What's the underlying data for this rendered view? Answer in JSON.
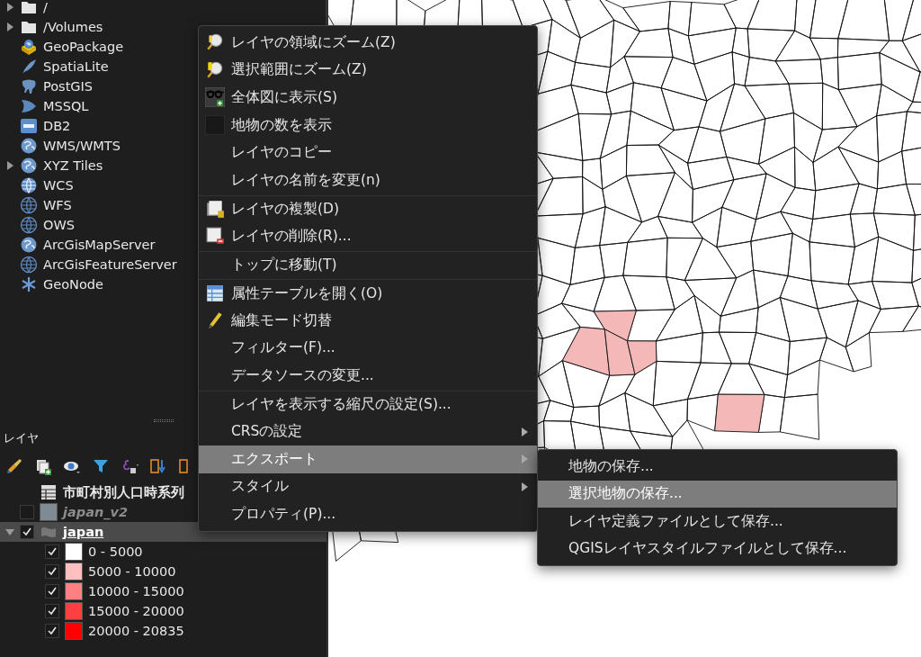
{
  "browser": {
    "items": [
      {
        "label": "/",
        "expandable": true
      },
      {
        "label": "/Volumes",
        "expandable": true
      },
      {
        "label": "GeoPackage",
        "expandable": false
      },
      {
        "label": "SpatiaLite",
        "expandable": false
      },
      {
        "label": "PostGIS",
        "expandable": false
      },
      {
        "label": "MSSQL",
        "expandable": false
      },
      {
        "label": "DB2",
        "expandable": false
      },
      {
        "label": "WMS/WMTS",
        "expandable": false
      },
      {
        "label": "XYZ Tiles",
        "expandable": true
      },
      {
        "label": "WCS",
        "expandable": false
      },
      {
        "label": "WFS",
        "expandable": false
      },
      {
        "label": "OWS",
        "expandable": false
      },
      {
        "label": "ArcGisMapServer",
        "expandable": false
      },
      {
        "label": "ArcGisFeatureServer",
        "expandable": false
      },
      {
        "label": "GeoNode",
        "expandable": false
      }
    ]
  },
  "layers_panel": {
    "title": "レイヤ",
    "tree": [
      {
        "label": "市町村別人口時系列",
        "kind": "table",
        "selected": false
      },
      {
        "label": "japan_v2",
        "kind": "layer",
        "checked": false,
        "selected": false,
        "color": "#7f8b94"
      },
      {
        "label": "japan",
        "kind": "polygon-layer",
        "checked": true,
        "expanded": true,
        "selected": true,
        "children": [
          {
            "label": "0 - 5000",
            "checked": true,
            "color": "#ffffff"
          },
          {
            "label": "5000 - 10000",
            "checked": true,
            "color": "#ffbfbf"
          },
          {
            "label": "10000 - 15000",
            "checked": true,
            "color": "#ff8080"
          },
          {
            "label": "15000 - 20000",
            "checked": true,
            "color": "#ff4040"
          },
          {
            "label": "20000 - 20835",
            "checked": true,
            "color": "#ff0000"
          }
        ]
      }
    ]
  },
  "context_menu": {
    "items": [
      {
        "label": "レイヤの領域にズーム(Z)",
        "separator_before": false,
        "submenu": false,
        "selected": false
      },
      {
        "label": "選択範囲にズーム(Z)",
        "separator_before": false,
        "submenu": false,
        "selected": false
      },
      {
        "label": "全体図に表示(S)",
        "separator_before": false,
        "submenu": false,
        "selected": false
      },
      {
        "label": "地物の数を表示",
        "checked": false,
        "separator_before": false,
        "submenu": false,
        "selected": false
      },
      {
        "label": "レイヤのコピー",
        "separator_before": false,
        "submenu": false,
        "selected": false
      },
      {
        "label": "レイヤの名前を変更(n)",
        "separator_before": false,
        "submenu": false,
        "selected": false
      },
      {
        "label": "レイヤの複製(D)",
        "separator_before": true,
        "submenu": false,
        "selected": false
      },
      {
        "label": "レイヤの削除(R)...",
        "separator_before": false,
        "submenu": false,
        "selected": false
      },
      {
        "label": "トップに移動(T)",
        "separator_before": true,
        "submenu": false,
        "selected": false
      },
      {
        "label": "属性テーブルを開く(O)",
        "separator_before": true,
        "submenu": false,
        "selected": false
      },
      {
        "label": "編集モード切替",
        "separator_before": false,
        "submenu": false,
        "selected": false
      },
      {
        "label": "フィルター(F)...",
        "separator_before": false,
        "submenu": false,
        "selected": false
      },
      {
        "label": "データソースの変更...",
        "separator_before": false,
        "submenu": false,
        "selected": false
      },
      {
        "label": "レイヤを表示する縮尺の設定(S)...",
        "separator_before": true,
        "submenu": false,
        "selected": false
      },
      {
        "label": "CRSの設定",
        "separator_before": false,
        "submenu": true,
        "selected": false
      },
      {
        "label": "エクスポート",
        "separator_before": false,
        "submenu": true,
        "selected": true
      },
      {
        "label": "スタイル",
        "separator_before": false,
        "submenu": true,
        "selected": false
      },
      {
        "label": "プロパティ(P)...",
        "separator_before": false,
        "submenu": false,
        "selected": false
      }
    ]
  },
  "export_submenu": {
    "items": [
      {
        "label": "地物の保存...",
        "selected": false
      },
      {
        "label": "選択地物の保存...",
        "selected": true
      },
      {
        "label": "レイヤ定義ファイルとして保存...",
        "selected": false
      },
      {
        "label": "QGISレイヤスタイルファイルとして保存...",
        "selected": false
      }
    ]
  }
}
